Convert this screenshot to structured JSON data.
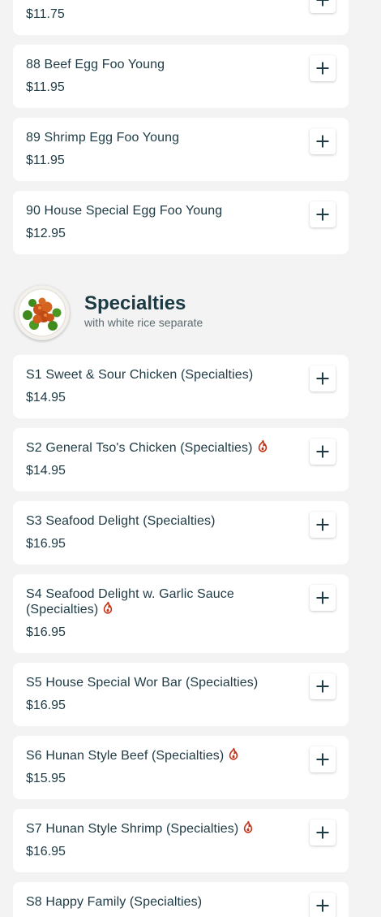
{
  "menu": {
    "top_card": {
      "price": "$11.75"
    },
    "egg_foo_young_items": [
      {
        "name": "88 Beef Egg Foo Young",
        "price": "$11.95"
      },
      {
        "name": "89 Shrimp Egg Foo Young",
        "price": "$11.95"
      },
      {
        "name": "90 House Special Egg Foo Young",
        "price": "$12.95"
      }
    ],
    "specialties_section": {
      "title": "Specialties",
      "subtitle": "with white rice separate",
      "items": [
        {
          "name": "S1 Sweet & Sour Chicken (Specialties)",
          "price": "$14.95",
          "spicy": false
        },
        {
          "name": "S2 General Tso's Chicken (Specialties)",
          "price": "$14.95",
          "spicy": true
        },
        {
          "name": "S3 Seafood Delight (Specialties)",
          "price": "$16.95",
          "spicy": false
        },
        {
          "name": "S4 Seafood Delight w. Garlic Sauce (Specialties)",
          "price": "$16.95",
          "spicy": true
        },
        {
          "name": "S5 House Special Wor Bar (Specialties)",
          "price": "$16.95",
          "spicy": false
        },
        {
          "name": "S6 Hunan Style Beef (Specialties)",
          "price": "$15.95",
          "spicy": true
        },
        {
          "name": "S7 Hunan Style Shrimp (Specialties)",
          "price": "$16.95",
          "spicy": true
        },
        {
          "name": "S8 Happy Family (Specialties)",
          "price": "",
          "spicy": false
        }
      ]
    }
  },
  "icons": {
    "add": "plus-icon",
    "spicy": "chili-pepper-icon",
    "section_image": "food-dish-image"
  },
  "colors": {
    "background": "#f3f3f3",
    "card": "#ffffff",
    "text": "#1e3a44",
    "subtitle": "#5d6b70",
    "spicy": "#c4341a"
  }
}
